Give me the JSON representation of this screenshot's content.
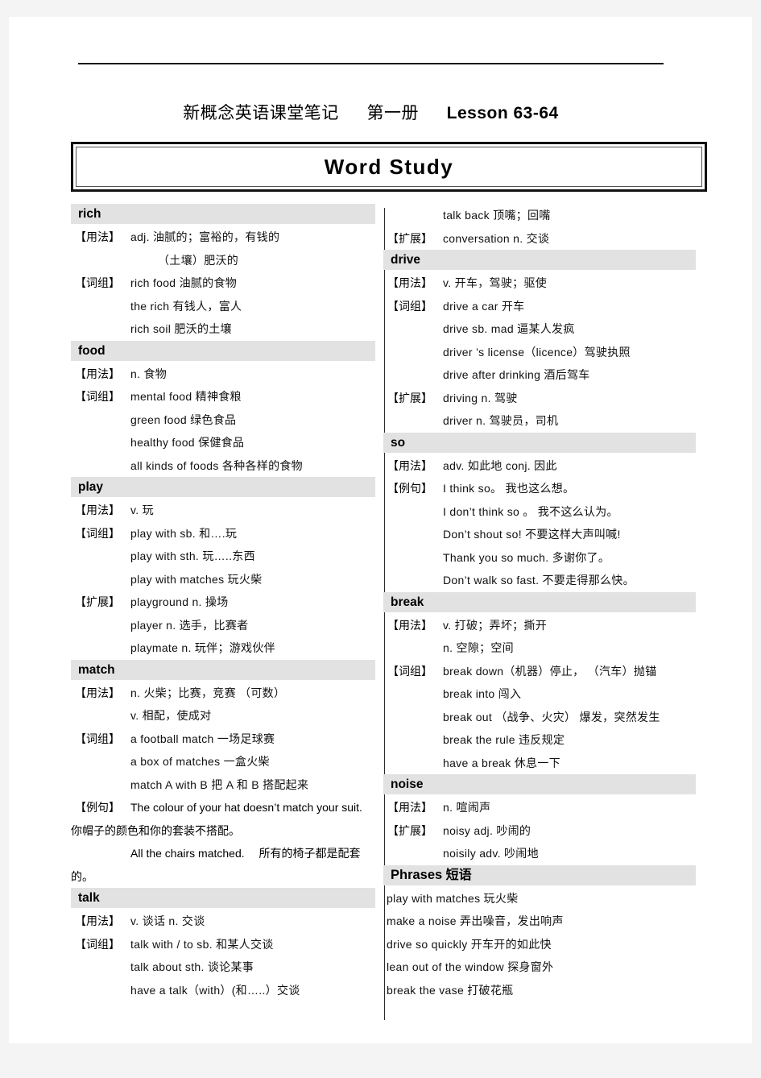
{
  "header": {
    "title_cn": "新概念英语课堂笔记",
    "volume": "第一册",
    "lesson": "Lesson 63-64",
    "banner": "Word Study"
  },
  "labels": {
    "usage": "【用法】",
    "phrase": "【词组】",
    "extend": "【扩展】",
    "example": "【例句】"
  },
  "left_column": [
    {
      "word": "rich",
      "rows": [
        {
          "label": "【用法】",
          "text": "adj.  油腻的；富裕的，有钱的"
        },
        {
          "label": "",
          "text": "（土壤）肥沃的",
          "extra_indent": true
        },
        {
          "label": "【词组】",
          "text": "rich food   油腻的食物"
        },
        {
          "label": "",
          "text": "the rich   有钱人，富人"
        },
        {
          "label": "",
          "text": "rich soil   肥沃的土壤"
        }
      ]
    },
    {
      "word": "food",
      "rows": [
        {
          "label": "【用法】",
          "text": "n.  食物"
        },
        {
          "label": "【词组】",
          "text": "mental food   精神食粮"
        },
        {
          "label": "",
          "text": "green food   绿色食品"
        },
        {
          "label": "",
          "text": "healthy food   保健食品"
        },
        {
          "label": "",
          "text": "all kinds of foods   各种各样的食物"
        }
      ]
    },
    {
      "word": "play",
      "rows": [
        {
          "label": "【用法】",
          "text": "v.  玩"
        },
        {
          "label": "【词组】",
          "text": "play with sb.  和….玩"
        },
        {
          "label": "",
          "text": "play with sth.  玩…..东西"
        },
        {
          "label": "",
          "text": "play with matches   玩火柴"
        },
        {
          "label": "【扩展】",
          "text": "playground n.   操场"
        },
        {
          "label": "",
          "text": "player n.  选手，比赛者"
        },
        {
          "label": "",
          "text": "playmate n.  玩伴；游戏伙伴"
        }
      ]
    },
    {
      "word": "match",
      "rows": [
        {
          "label": "【用法】",
          "text": "n.  火柴；比赛，竞赛     （可数）"
        },
        {
          "label": "",
          "text": "v.  相配，使成对"
        },
        {
          "label": "【词组】",
          "text": "a football match   一场足球赛"
        },
        {
          "label": "",
          "text": "a box of matches   一盒火柴"
        },
        {
          "label": "",
          "text": "match A with B  把 A 和 B 搭配起来"
        }
      ],
      "wrapped": [
        {
          "label": "【例句】",
          "text": "The colour  of your  hat doesn’t match your suit.　 你帽子的颜色和你的套装不搭配。"
        },
        {
          "label": "",
          "text": "All  the  chairs  matched.　  所有的椅子都是配套的。"
        }
      ]
    },
    {
      "word": "talk",
      "rows": [
        {
          "label": "【用法】",
          "text": "v.  谈话  n.  交谈"
        },
        {
          "label": "【词组】",
          "text": "talk with / to sb.   和某人交谈"
        },
        {
          "label": "",
          "text": "talk about sth.  谈论某事"
        },
        {
          "label": "",
          "text": "have a talk（with）(和…..）交谈"
        }
      ]
    }
  ],
  "right_column_top": [
    {
      "label": "",
      "text": "talk back  顶嘴；回嘴"
    },
    {
      "label": "【扩展】",
      "text": "conversation n.   交谈"
    }
  ],
  "right_column": [
    {
      "word": "drive",
      "rows": [
        {
          "label": "【用法】",
          "text": "v. 开车，驾驶；驱使"
        },
        {
          "label": "【词组】",
          "text": "drive a car  开车"
        },
        {
          "label": "",
          "text": "drive sb. mad   逼某人发疯"
        },
        {
          "label": "",
          "text": "driver ’s license（licence）驾驶执照"
        },
        {
          "label": "",
          "text": "drive after drinking    酒后驾车"
        },
        {
          "label": "【扩展】",
          "text": "driving n.   驾驶"
        },
        {
          "label": "",
          "text": "driver n.  驾驶员，司机"
        }
      ]
    },
    {
      "word": "so",
      "rows": [
        {
          "label": "【用法】",
          "text": "adv. 如此地    conj.  因此"
        },
        {
          "label": "【例句】",
          "text": "I think so。  我也这么想。"
        },
        {
          "label": "",
          "text": "I don’t think so 。  我不这么认为。"
        },
        {
          "label": "",
          "text": "Don’t shout so!  不要这样大声叫喊!"
        },
        {
          "label": "",
          "text": "Thank you so much.  多谢你了。"
        },
        {
          "label": "",
          "text": "Don’t walk so fast.  不要走得那么快。"
        }
      ]
    },
    {
      "word": "break",
      "rows": [
        {
          "label": "【用法】",
          "text": "v.  打破；弄坏；撕开"
        },
        {
          "label": "",
          "text": "n.  空隙；空间"
        },
        {
          "label": "【词组】",
          "text": "break down（机器）停止，  （汽车）抛锚"
        },
        {
          "label": "",
          "text": "break into  闯入"
        },
        {
          "label": "",
          "text": "break out  （战争、火灾）  爆发，突然发生"
        },
        {
          "label": "",
          "text": "break the rule   违反规定"
        },
        {
          "label": "",
          "text": "have a break  休息一下"
        }
      ]
    },
    {
      "word": "noise",
      "rows": [
        {
          "label": "【用法】",
          "text": "n.  喧闹声"
        },
        {
          "label": "【扩展】",
          "text": "noisy adj.   吵闹的"
        },
        {
          "label": "",
          "text": "noisily adv.  吵闹地"
        }
      ]
    }
  ],
  "phrases_section": {
    "heading_en": "Phrases",
    "heading_cn": "短语",
    "items": [
      "play with matches    玩火柴",
      "make a noise   弄出噪音，发出响声",
      "drive so quickly   开车开的如此快",
      "lean out of the window    探身窗外",
      "break the vase  打破花瓶"
    ]
  }
}
